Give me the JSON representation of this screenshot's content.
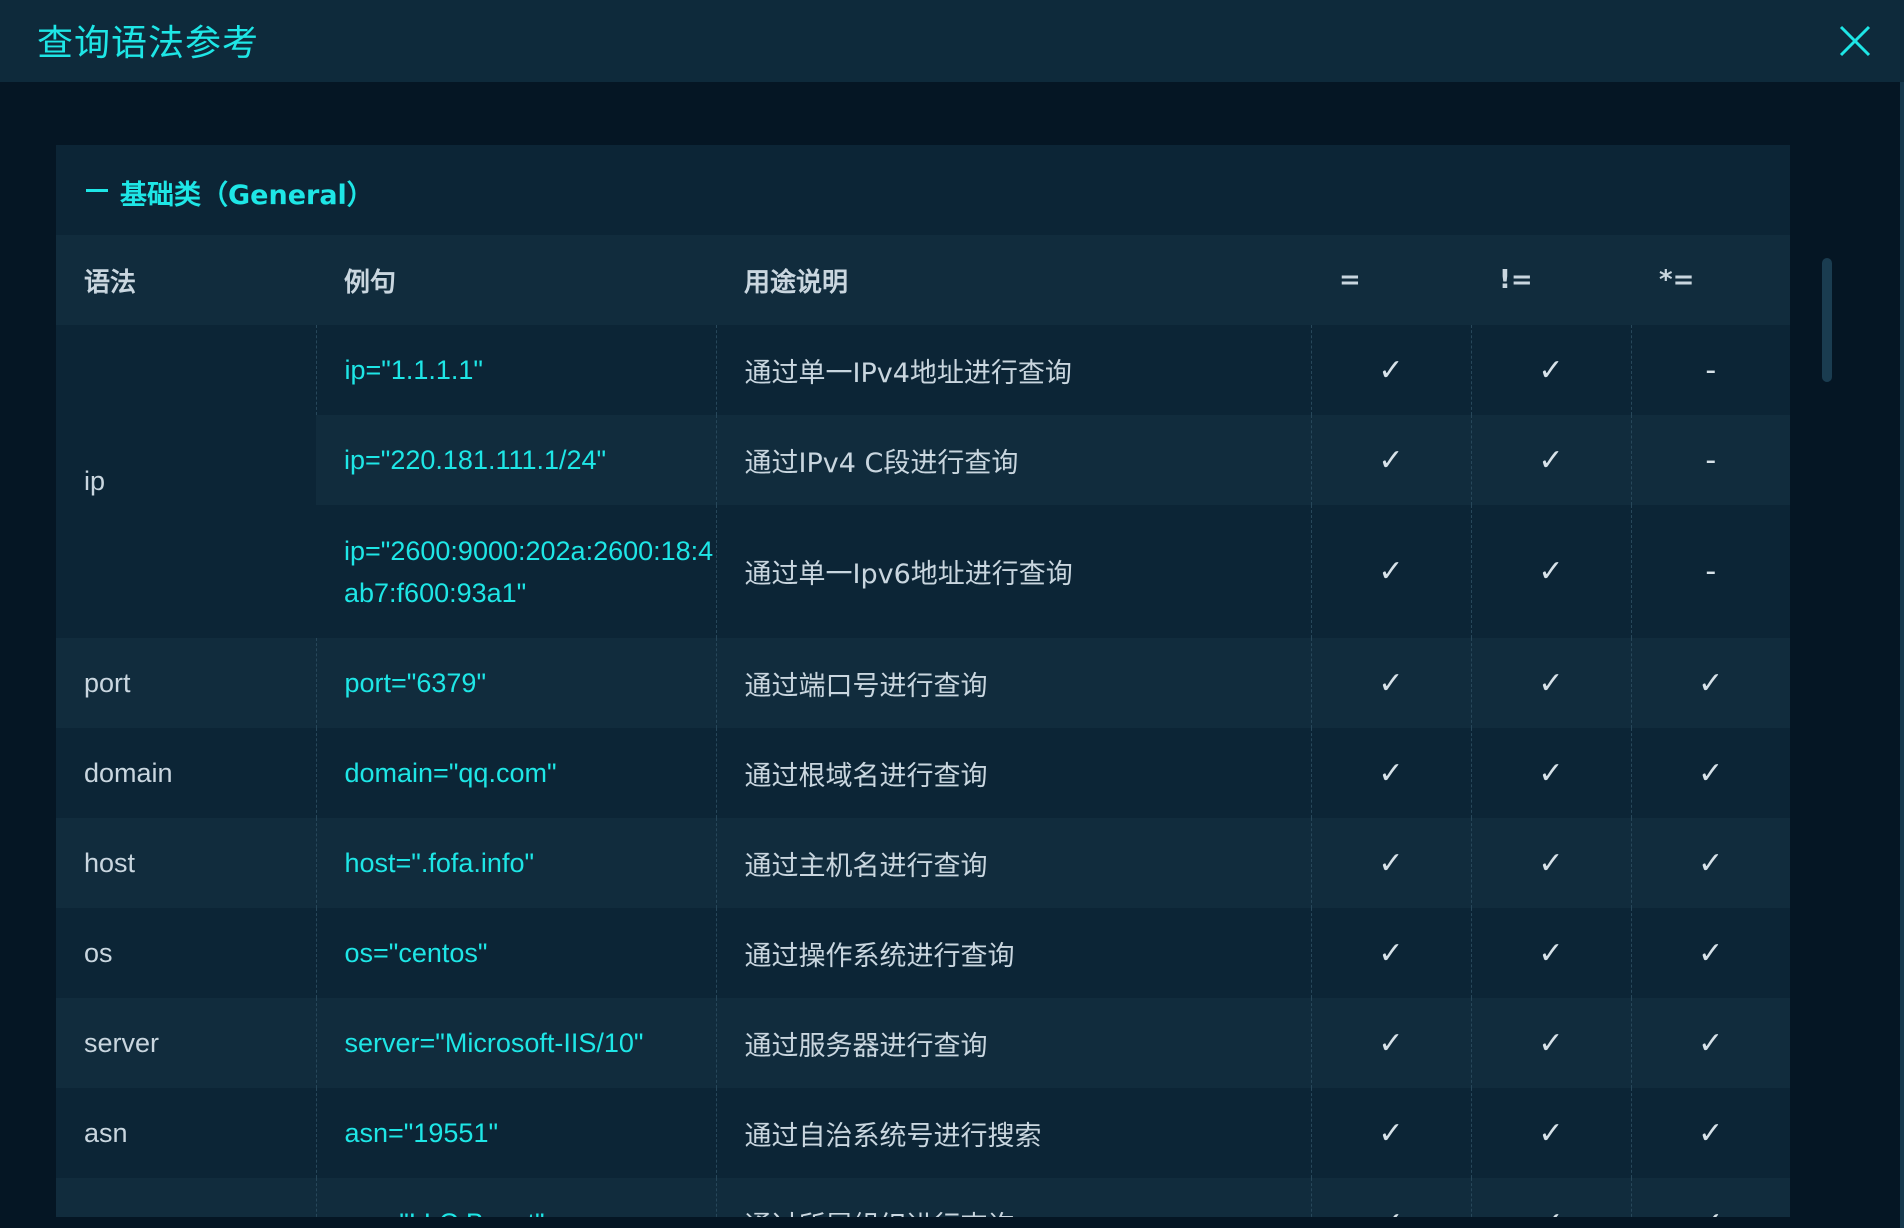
{
  "modal": {
    "title": "查询语法参考"
  },
  "section": {
    "title": "基础类（General）"
  },
  "columns": {
    "syntax": "语法",
    "example": "例句",
    "description": "用途说明",
    "eq": "=",
    "neq": "!=",
    "wildcard": "*="
  },
  "rows": {
    "ip": {
      "syntax": "ip",
      "r1": {
        "example": "ip=\"1.1.1.1\"",
        "description": "通过单一IPv4地址进行查询",
        "eq": "✓",
        "neq": "✓",
        "wildcard": "-"
      },
      "r2": {
        "example": "ip=\"220.181.111.1/24\"",
        "description": "通过IPv4 C段进行查询",
        "eq": "✓",
        "neq": "✓",
        "wildcard": "-"
      },
      "r3": {
        "example": "ip=\"2600:9000:202a:2600:18:4ab7:f600:93a1\"",
        "description": "通过单一Ipv6地址进行查询",
        "eq": "✓",
        "neq": "✓",
        "wildcard": "-"
      }
    },
    "port": {
      "syntax": "port",
      "example": "port=\"6379\"",
      "description": "通过端口号进行查询",
      "eq": "✓",
      "neq": "✓",
      "wildcard": "✓"
    },
    "domain": {
      "syntax": "domain",
      "example": "domain=\"qq.com\"",
      "description": "通过根域名进行查询",
      "eq": "✓",
      "neq": "✓",
      "wildcard": "✓"
    },
    "host": {
      "syntax": "host",
      "example": "host=\".fofa.info\"",
      "description": "通过主机名进行查询",
      "eq": "✓",
      "neq": "✓",
      "wildcard": "✓"
    },
    "os": {
      "syntax": "os",
      "example": "os=\"centos\"",
      "description": "通过操作系统进行查询",
      "eq": "✓",
      "neq": "✓",
      "wildcard": "✓"
    },
    "server": {
      "syntax": "server",
      "example": "server=\"Microsoft-IIS/10\"",
      "description": "通过服务器进行查询",
      "eq": "✓",
      "neq": "✓",
      "wildcard": "✓"
    },
    "asn": {
      "syntax": "asn",
      "example": "asn=\"19551\"",
      "description": "通过自治系统号进行搜索",
      "eq": "✓",
      "neq": "✓",
      "wildcard": "✓"
    },
    "org": {
      "syntax": "org",
      "example": "org=\"LLC Baxet\"",
      "description": "通过所属组织进行查询",
      "eq": "✓",
      "neq": "✓",
      "wildcard": "✓"
    }
  },
  "colors": {
    "accent": "#1ee6e6",
    "header_bg": "#0e2a3b",
    "row_odd": "#0c2536",
    "row_even": "#112c3d"
  },
  "icons": {
    "close": "close-icon",
    "section": "dash-icon",
    "check": "check-icon"
  }
}
